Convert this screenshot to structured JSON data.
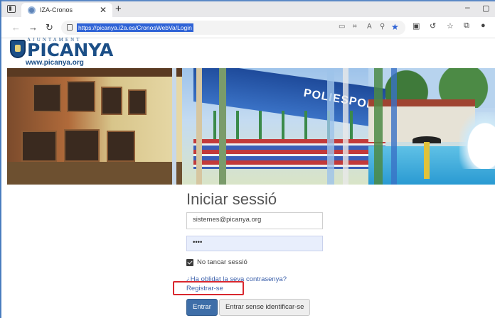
{
  "browser": {
    "tab_title": "IZA-Cronos",
    "new_tab_glyph": "+",
    "url": "https://picanya.i2a.es/CronosWebVa/Login",
    "minimize_glyph": "–",
    "restore_glyph": "▢"
  },
  "site": {
    "logo_top": "AJUNTAMENT",
    "logo_name": "PICANYA",
    "logo_url": "www.picanya.org",
    "banner_text": "POLIESPORTIU"
  },
  "login": {
    "title": "Iniciar sessió",
    "username_value": "sistemes@picanya.org",
    "password_value": "••••",
    "remember_checked": true,
    "remember_label": "No tancar sessió",
    "forgot_link": "¿Ha oblidat la seva contrasenya?",
    "register_link": "Registrar-se",
    "enter_button": "Entrar",
    "anonymous_button": "Entrar sense identificar-se"
  },
  "colors": {
    "browser_accent": "#2f63d6",
    "primary_button": "#3e6ea8",
    "link": "#3a5faa",
    "highlight_box": "#d9272e",
    "logo": "#1c4f87"
  },
  "icons": [
    "tab-actions-icon",
    "tab-favicon-icon",
    "tab-close-icon",
    "new-tab-icon",
    "back-icon",
    "forward-icon",
    "reload-icon",
    "lock-icon",
    "reader-icon",
    "translate-icon",
    "read-aloud-icon",
    "zoom-icon",
    "favorite-star-icon",
    "split-screen-icon",
    "refresh-icon",
    "favorites-icon",
    "collections-icon",
    "profile-icon"
  ]
}
